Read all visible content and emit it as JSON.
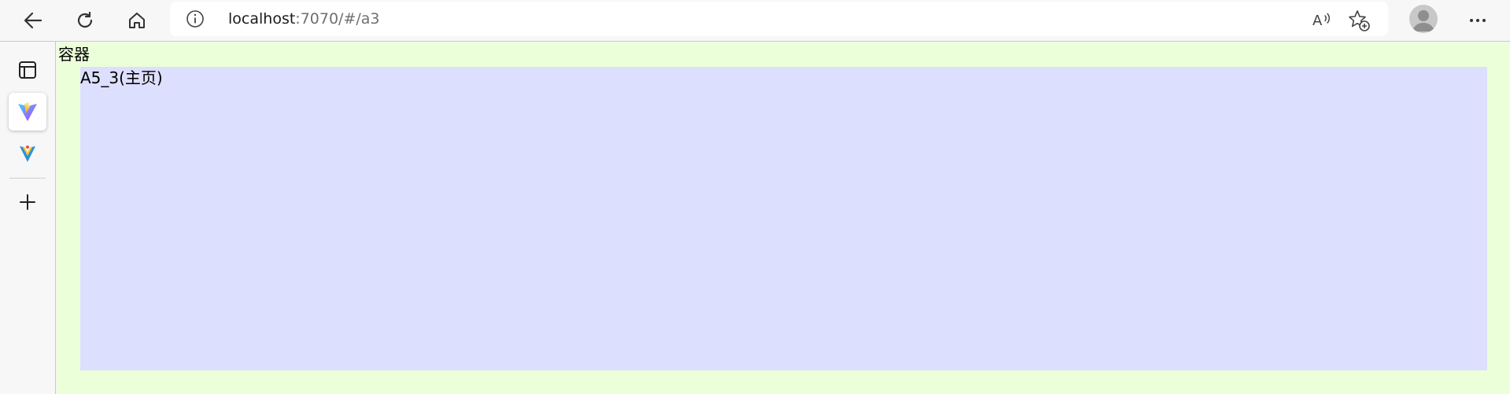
{
  "browser": {
    "address": {
      "host": "localhost",
      "path": ":7070/#/a3"
    },
    "icons": {
      "back": "back-arrow-icon",
      "reload": "reload-icon",
      "home": "home-icon",
      "info": "info-icon",
      "read_aloud": "read-aloud-icon",
      "favorites": "add-favorite-icon",
      "profile": "profile-avatar-icon",
      "more": "more-options-icon"
    }
  },
  "sidebar": {
    "items": [
      {
        "icon": "tab-actions-icon"
      },
      {
        "icon": "vite-logo-icon",
        "active": true
      },
      {
        "icon": "vitest-logo-icon"
      },
      {
        "icon": "add-icon"
      }
    ]
  },
  "page": {
    "container_label": "容器",
    "inner_label": "A5_3(主页)",
    "colors": {
      "outer_bg": "#ebffd9",
      "inner_bg": "#dddfff"
    }
  }
}
